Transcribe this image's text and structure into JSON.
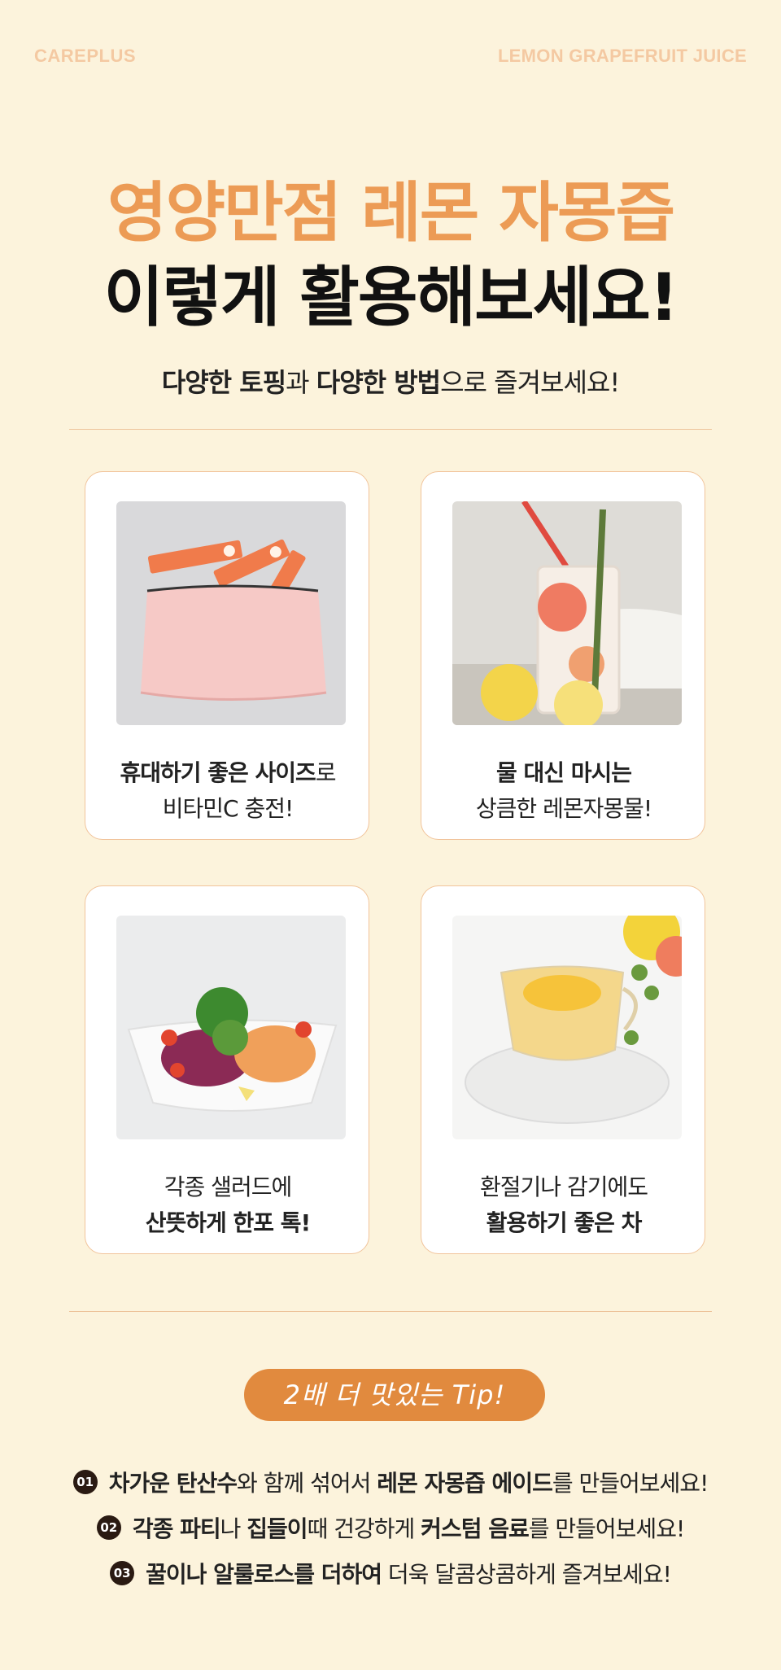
{
  "brand": {
    "left": "CAREPLUS",
    "right": "LEMON GRAPEFRUIT JUICE"
  },
  "hero": {
    "title_line1": "영양만점 레몬 자몽즙",
    "title_line2": "이렇게 활용해보세요!",
    "subtitle": {
      "part1_bold": "다양한 토핑",
      "part2": "과 ",
      "part3_bold": "다양한 방법",
      "part4": "으로 즐겨보세요!"
    }
  },
  "cards": [
    {
      "image": "pouch-with-sticks",
      "line1_bold": "휴대하기 좋은 사이즈",
      "line1_rest": "로",
      "line2": "비타민C 충전!",
      "line2_bold": ""
    },
    {
      "image": "grapefruit-water-glass",
      "line1_bold": "물 대신 마시는",
      "line1_rest": "",
      "line2": "상큼한 레몬자몽물!",
      "line2_bold": ""
    },
    {
      "image": "salad-bowl",
      "line1_bold": "",
      "line1_rest": "각종 샐러드에",
      "line2": "",
      "line2_bold": "산뜻하게 한포 톡!"
    },
    {
      "image": "lemon-tea-cup",
      "line1_bold": "",
      "line1_rest": "환절기나 감기에도",
      "line2": "",
      "line2_bold": "활용하기 좋은 차"
    }
  ],
  "tip": {
    "label": "2배 더 맛있는 Tip!",
    "items": [
      {
        "num": "01",
        "b1": "차가운 탄산수",
        "t1": "와 함께 섞어서 ",
        "b2": "레몬 자몽즙 에이드",
        "t2": "를 만들어보세요!"
      },
      {
        "num": "02",
        "b1": "각종 파티",
        "t1": "나 ",
        "b2": "집들이",
        "t2": "때 건강하게 ",
        "b3": "커스텀 음료",
        "t3": "를 만들어보세요!"
      },
      {
        "num": "03",
        "b1": "꿀이나 알룰로스를 더하여",
        "t1": " 더욱 달콤상콤하게 즐겨보세요!"
      }
    ]
  },
  "colors": {
    "background": "#fcf3dc",
    "accent": "#ec9b55",
    "pill": "#e18a3e",
    "card_border": "#f1c49b"
  }
}
